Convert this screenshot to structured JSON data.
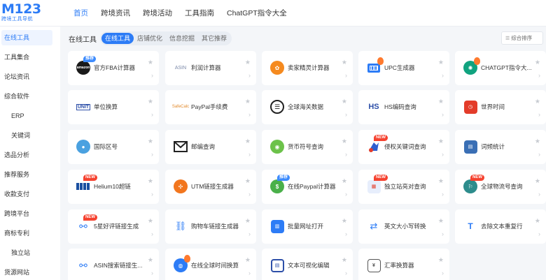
{
  "logo": {
    "main": "M123",
    "sub": "跨境工具导航"
  },
  "nav": [
    "首页",
    "跨境资讯",
    "跨境活动",
    "工具指南",
    "ChatGPT指令大全"
  ],
  "sidebar": [
    {
      "label": "在线工具",
      "active": true
    },
    {
      "label": "工具集合"
    },
    {
      "label": "论坛资讯"
    },
    {
      "label": "综合软件"
    },
    {
      "label": "ERP",
      "sub": true
    },
    {
      "label": "关键词",
      "sub": true
    },
    {
      "label": "选品分析"
    },
    {
      "label": "推荐服务"
    },
    {
      "label": "收款支付"
    },
    {
      "label": "跨境平台"
    },
    {
      "label": "商标专利"
    },
    {
      "label": "独立站",
      "sub": true
    },
    {
      "label": "货源网站"
    }
  ],
  "filter": {
    "title": "在线工具",
    "tabs": [
      "在线工具",
      "店铺优化",
      "信息挖掘",
      "其它推荐"
    ],
    "sort_label": "综合排序"
  },
  "badges": {
    "hot": "推荐",
    "new": "NEW"
  },
  "cards": [
    {
      "label": "官方FBA计算器",
      "icon": "amazon-icon",
      "badge": "hot"
    },
    {
      "label": "利润计算器",
      "icon": "asin-icon"
    },
    {
      "label": "卖家精灵计算器",
      "icon": "seller-sprite-icon"
    },
    {
      "label": "UPC生成器",
      "icon": "upc-icon",
      "fire": true
    },
    {
      "label": "CHATGPT指令大...",
      "icon": "chatgpt-icon",
      "fire": true
    },
    {
      "label": "单位换算",
      "icon": "unit-icon"
    },
    {
      "label": "PayPal手续费",
      "icon": "safecalc-icon"
    },
    {
      "label": "全球海关数据",
      "icon": "customs-icon"
    },
    {
      "label": "HS编码查询",
      "icon": "hs-icon"
    },
    {
      "label": "世界时间",
      "icon": "world-clock-icon"
    },
    {
      "label": "国际区号",
      "icon": "globe-icon"
    },
    {
      "label": "邮编查询",
      "icon": "mail-icon"
    },
    {
      "label": "货币符号查询",
      "icon": "frog-icon"
    },
    {
      "label": "侵权关键词查询",
      "icon": "shield-icon",
      "badge": "new"
    },
    {
      "label": "词频统计",
      "icon": "word-freq-icon"
    },
    {
      "label": "Helium10超链",
      "icon": "helium-icon",
      "badge": "new"
    },
    {
      "label": "UTM链接生成器",
      "icon": "utm-icon"
    },
    {
      "label": "在线Paypal计算器",
      "icon": "paypal-calc-icon",
      "badge": "hot"
    },
    {
      "label": "独立站亮对查询",
      "icon": "store-icon",
      "badge": "new"
    },
    {
      "label": "全球物流号查询",
      "icon": "logistics-icon",
      "badge": "new"
    },
    {
      "label": "5星好评链接生成",
      "icon": "link-icon",
      "badge": "new"
    },
    {
      "label": "购物车链接生成器",
      "icon": "cart-icon"
    },
    {
      "label": "批量网址打开",
      "icon": "batch-url-icon"
    },
    {
      "label": "英文大小写转换",
      "icon": "case-convert-icon"
    },
    {
      "label": "去除文本重复行",
      "icon": "text-dedupe-icon"
    },
    {
      "label": "ASIN搜索链接生...",
      "icon": "asin-link-icon"
    },
    {
      "label": "在线全球时间换算",
      "icon": "world-time-convert-icon",
      "fire": true
    },
    {
      "label": "文本可视化编辑",
      "icon": "text-edit-icon"
    },
    {
      "label": "汇率换算器",
      "icon": "exchange-icon"
    }
  ],
  "icon_text": {
    "amazon": "amazon",
    "asin": "ASIN",
    "unit": "UNIT",
    "safecalc": "SafeCalc",
    "hs": "HS"
  },
  "colors": {
    "accent": "#2d7cf6",
    "new_badge": "#f5422f",
    "hot_badge": "#3d8bfd"
  }
}
